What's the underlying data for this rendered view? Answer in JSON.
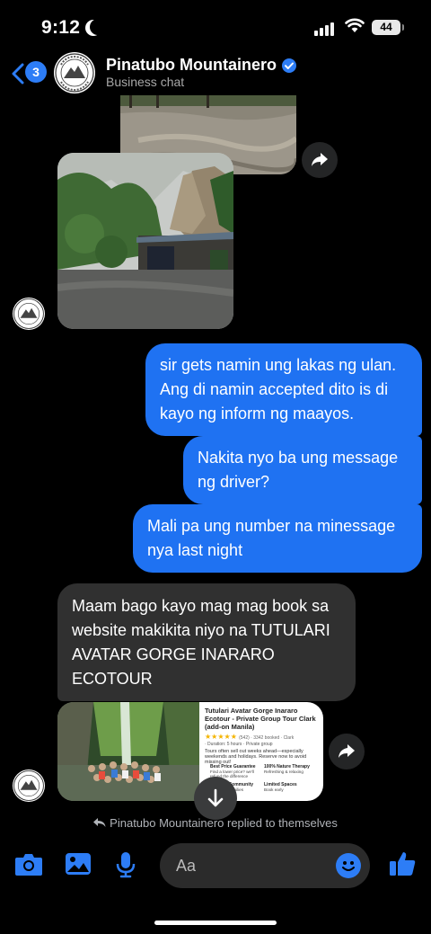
{
  "status_bar": {
    "time": "9:12",
    "battery": "44"
  },
  "header": {
    "unread_count": "3",
    "title": "Pinatubo Mountainero",
    "subtitle": "Business chat",
    "avatar_icon": "pinatubo-mountaineers-logo"
  },
  "messages": [
    {
      "type": "image",
      "direction": "incoming",
      "description_icon": "mudslide-photo"
    },
    {
      "type": "image",
      "direction": "incoming",
      "description_icon": "landslide-photo"
    },
    {
      "type": "text",
      "direction": "outgoing",
      "lines": [
        "sir gets namin ung lakas ng ulan.",
        "Ang di namin accepted dito is di",
        "kayo ng inform ng maayos."
      ]
    },
    {
      "type": "text",
      "direction": "outgoing",
      "lines": [
        "Nakita nyo ba ung message",
        "ng driver?"
      ]
    },
    {
      "type": "text",
      "direction": "outgoing",
      "lines": [
        "Mali pa ung number na minessage",
        "nya last night"
      ]
    },
    {
      "type": "text",
      "direction": "incoming",
      "lines": [
        "Maam bago kayo mag mag book sa",
        "website makikita niyo na TUTULARI",
        "AVATAR GORGE INARARO",
        "ECOTOUR"
      ]
    }
  ],
  "link_card": {
    "title": "Tutulari Avatar Gorge Inararo Ecotour - Private Group Tour Clark (add-on Manila)",
    "stars": "★★★★★",
    "rating_text": "(542) · 3342 booked · Clark",
    "meta": "· Duration: 5 hours · Private group",
    "note": "Tours often sell out weeks ahead—especially weekends and holidays. Reserve now to avoid missing out!",
    "features": [
      {
        "title": "Best Price Guarantee",
        "text": "Find a lower price? we'll refund the difference"
      },
      {
        "title": "100% Nature Therapy",
        "text": "Refreshing & relaxing"
      },
      {
        "title": "Support Community",
        "text": "Help local families"
      },
      {
        "title": "Limited Spaces",
        "text": "Book early"
      }
    ]
  },
  "reply_note": "Pinatubo Mountainero replied to themselves",
  "composer": {
    "placeholder": "Aa"
  },
  "colors": {
    "accent": "#1f72f2",
    "incoming_bubble": "#303030",
    "background": "#000000"
  }
}
